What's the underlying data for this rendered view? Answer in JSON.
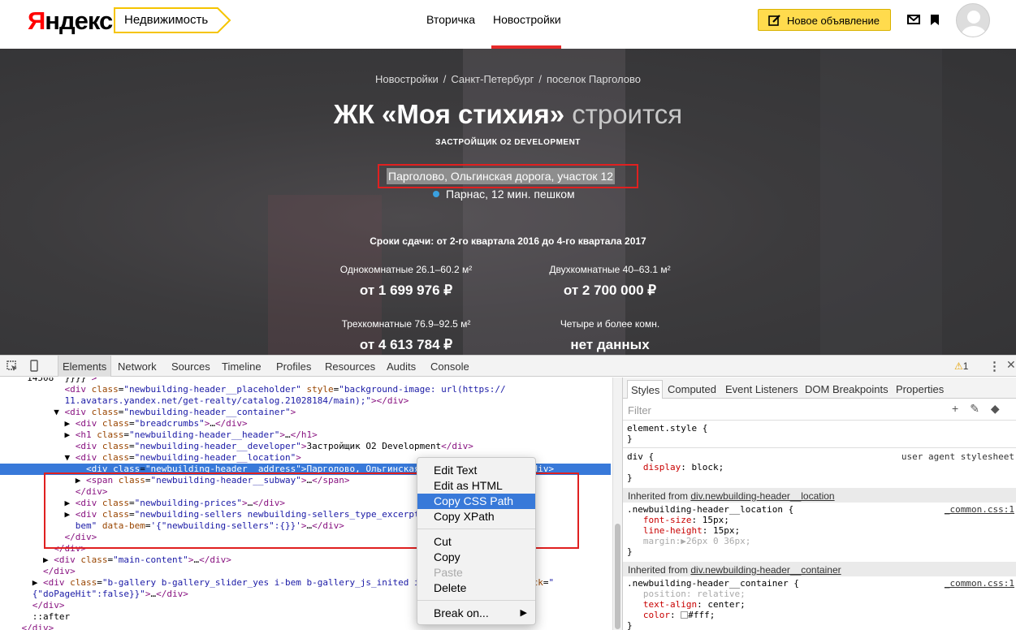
{
  "header": {
    "logo": "Яндекс",
    "service": "Недвижимость",
    "nav": [
      "Вторичка",
      "Новостройки"
    ],
    "new_ad": "Новое объявление"
  },
  "hero": {
    "breadcrumbs": [
      "Новостройки",
      "Санкт-Петербург",
      "поселок Парголово"
    ],
    "title": "ЖК «Моя стихия»",
    "status": "строится",
    "developer": "ЗАСТРОЙЩИК O2 DEVELOPMENT",
    "address": "Парголово, Ольгинская дорога, участок 12",
    "subway": "Парнас, 12 мин. пешком",
    "deadline": "Сроки сдачи: от 2-го квартала 2016 до 4-го квартала 2017",
    "prices": [
      {
        "label": "Однокомнатные 26.1–60.2 м²",
        "value": "от 1 699 976 ₽"
      },
      {
        "label": "Двухкомнатные 40–63.1 м²",
        "value": "от 2 700 000 ₽"
      },
      {
        "label": "Трехкомнатные 76.9–92.5 м²",
        "value": "от 4 613 784 ₽"
      },
      {
        "label": "Четыре и более комн.",
        "value": "нет данных"
      }
    ]
  },
  "devtools": {
    "tabs": [
      "Elements",
      "Network",
      "Sources",
      "Timeline",
      "Profiles",
      "Resources",
      "Audits",
      "Console"
    ],
    "warning_count": "1",
    "styles_tabs": [
      "Styles",
      "Computed",
      "Event Listeners",
      "DOM Breakpoints",
      "Properties"
    ],
    "filter_placeholder": "Filter"
  },
  "context_menu": {
    "items": [
      "Edit Text",
      "Edit as HTML",
      "Copy CSS Path",
      "Copy XPath",
      "Cut",
      "Copy",
      "Paste",
      "Delete",
      "Break on..."
    ],
    "highlighted": "Copy CSS Path"
  },
  "colors": {
    "accent_yellow": "#ffdb4d",
    "nav_underline": "#e62a2a",
    "highlight_red": "#e02020",
    "selection_blue": "#3879d9"
  }
}
